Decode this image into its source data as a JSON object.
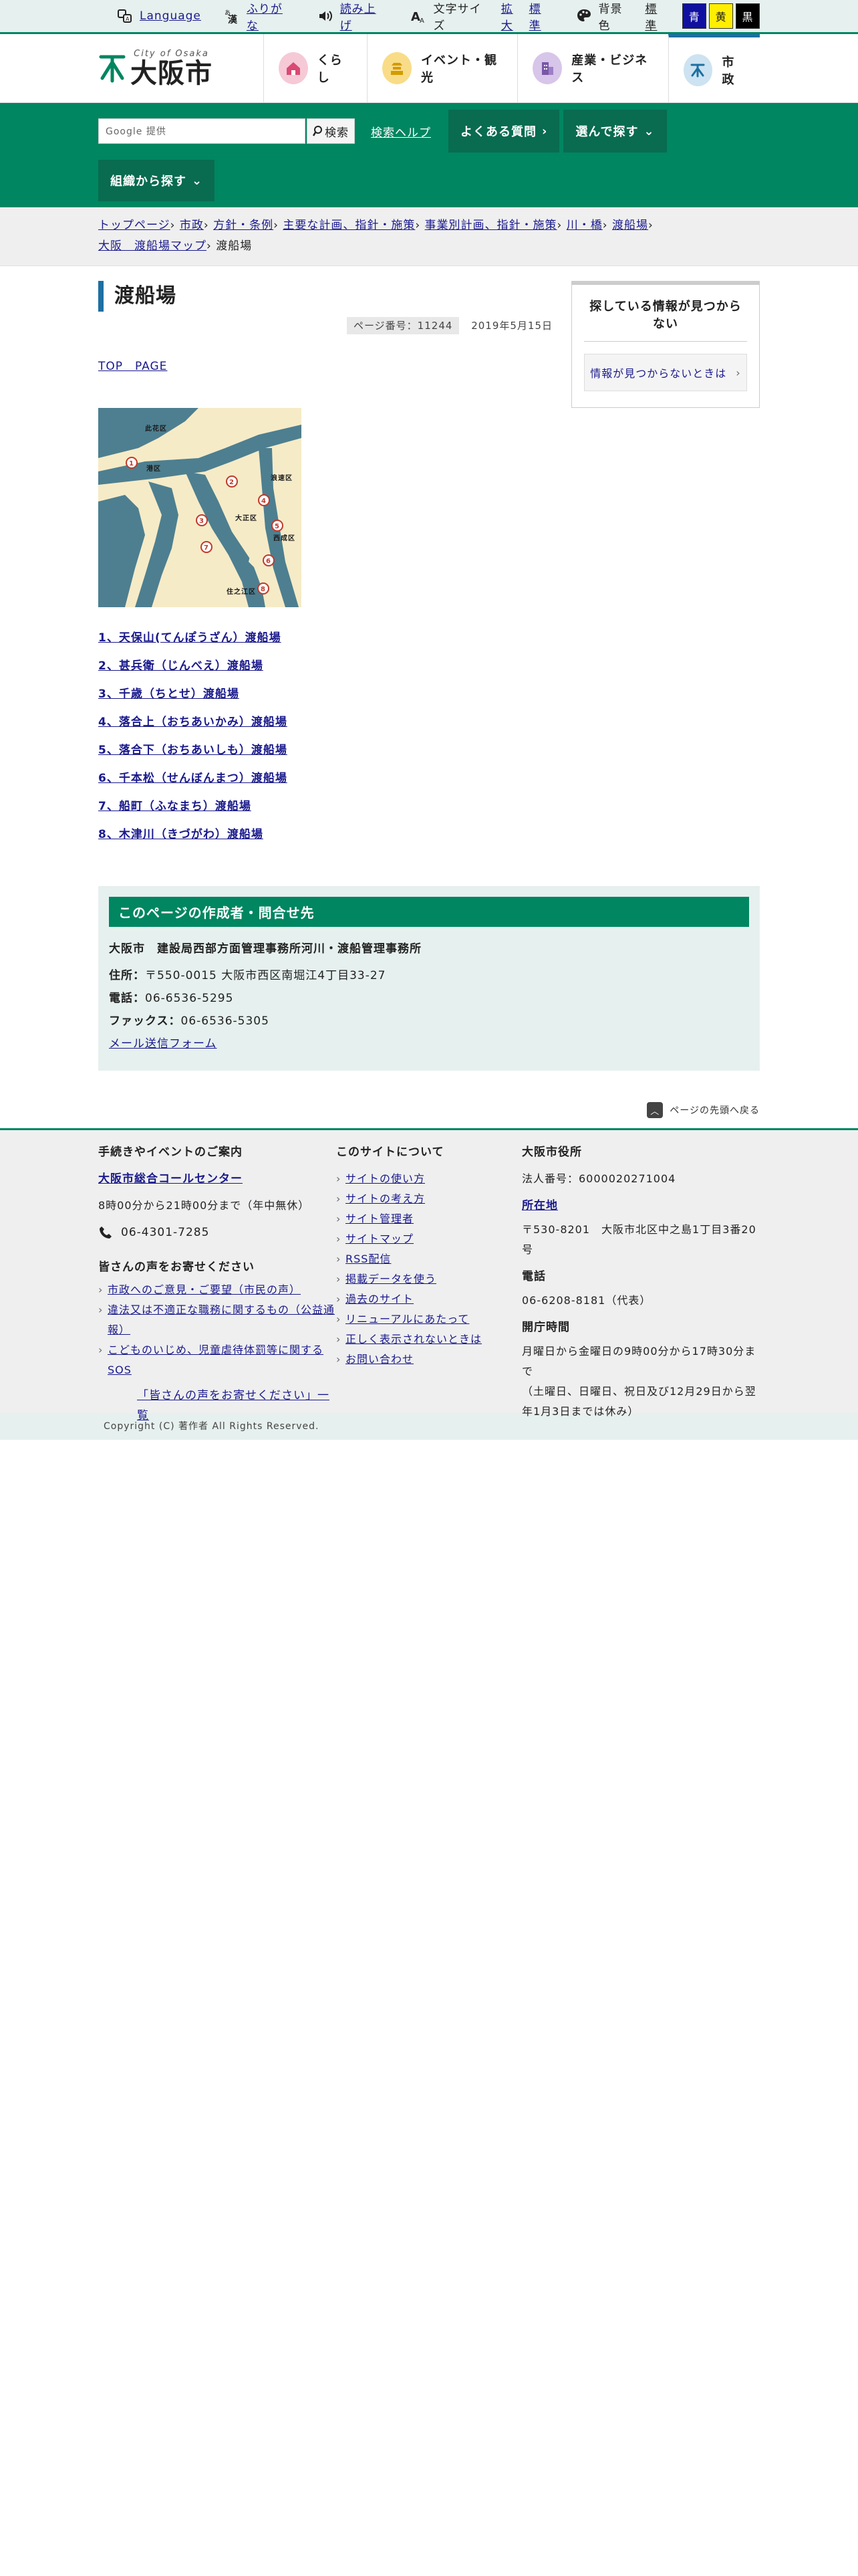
{
  "util": {
    "language": "Language",
    "furigana": "ふりがな",
    "read_aloud": "読み上げ",
    "font_size_label": "文字サイズ",
    "font_large": "拡大",
    "font_standard": "標準",
    "bg_label": "背景色",
    "bg_standard": "標準",
    "bg_blue": "青",
    "bg_yellow": "黄",
    "bg_black": "黒"
  },
  "header": {
    "logo_en": "City of Osaka",
    "logo_ja": "大阪市",
    "nav": [
      {
        "label": "くらし",
        "icon": "house-icon",
        "color": "#f6c9d6"
      },
      {
        "label": "イベント・観光",
        "icon": "castle-icon",
        "color": "#f9dc87"
      },
      {
        "label": "産業・ビジネス",
        "icon": "building-icon",
        "color": "#d7c5ea"
      },
      {
        "label": "市政",
        "icon": "city-mark-icon",
        "color": "#cde3f1"
      }
    ]
  },
  "search": {
    "placeholder": "Google 提供",
    "button": "検索",
    "help": "検索ヘルプ",
    "faq": "よくある質問",
    "choose": "選んで探す",
    "org": "組織から探す"
  },
  "breadcrumb": [
    "トップページ",
    "市政",
    "方針・条例",
    "主要な計画、指針・施策",
    "事業別計画、指針・施策",
    "川・橋",
    "渡船場",
    "大阪　渡船場マップ",
    "渡船場"
  ],
  "page": {
    "title": "渡船場",
    "page_number": "ページ番号：11244",
    "date": "2019年5月15日",
    "top_link": "TOP　PAGE",
    "ferries": [
      "1、天保山(てんぽうざん）渡船場",
      "2、甚兵衛（じんべえ）渡船場",
      "3、千歳（ちとせ）渡船場",
      "4、落合上（おちあいかみ）渡船場",
      "5、落合下（おちあいしも）渡船場",
      "6、千本松（せんぼんまつ）渡船場",
      "7、船町（ふなまち）渡船場",
      "8、木津川（きづがわ）渡船場"
    ],
    "map_labels": {
      "konohana": "此花区",
      "minato": "港区",
      "nishinari": "西成区",
      "taisho": "大正区",
      "naniwa": "浪速区",
      "suminoe": "住之江区"
    }
  },
  "side": {
    "title": "探している情報が見つからない",
    "button": "情報が見つからないときは"
  },
  "contact": {
    "heading": "このページの作成者・問合せ先",
    "name": "大阪市　建設局西部方面管理事務所河川・渡船管理事務所",
    "address_label": "住所：",
    "address": "〒550-0015 大阪市西区南堀江4丁目33-27",
    "phone_label": "電話：",
    "phone": "06-6536-5295",
    "fax_label": "ファックス：",
    "fax": "06-6536-5305",
    "mail": "メール送信フォーム"
  },
  "pagetop": "ページの先頭へ戻る",
  "footer": {
    "col1_title": "手続きやイベントのご案内",
    "callcenter": "大阪市総合コールセンター",
    "hours": "8時00分から21時00分まで（年中無休）",
    "phone": "06-4301-7285",
    "voice_title": "皆さんの声をお寄せください",
    "voice_links": [
      "市政へのご意見・ご要望（市民の声）",
      "違法又は不適正な職務に関するもの（公益通報）",
      "こどものいじめ、児童虐待体罰等に関するSOS"
    ],
    "voice_list": "「皆さんの声をお寄せください」一覧",
    "col2_title": "このサイトについて",
    "col2_links": [
      "サイトの使い方",
      "サイトの考え方",
      "サイト管理者",
      "サイトマップ",
      "RSS配信",
      "掲載データを使う",
      "過去のサイト",
      "リニューアルにあたって",
      "正しく表示されないときは",
      "お問い合わせ"
    ],
    "col3_title": "大阪市役所",
    "corp_no": "法人番号：6000020271004",
    "location_title": "所在地",
    "location": "〒530-8201　大阪市北区中之島1丁目3番20号",
    "tel_title": "電話",
    "tel": "06-6208-8181（代表）",
    "open_title": "開庁時間",
    "open": "月曜日から金曜日の9時00分から17時30分まで",
    "closed": "（土曜日、日曜日、祝日及び12月29日から翌年1月3日までは休み）"
  },
  "copyright": "Copyright (C) 著作者 All Rights Reserved."
}
